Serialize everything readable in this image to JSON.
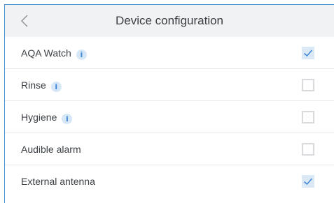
{
  "header": {
    "title": "Device configuration",
    "back_icon": "chevron-left-icon"
  },
  "info_icon_glyph": "i",
  "colors": {
    "accent": "#3d86d6",
    "checked_bg": "#dbe9f7",
    "header_bg": "#f1f2f4",
    "info_bg": "#d6e8f8"
  },
  "settings": [
    {
      "label": "AQA Watch",
      "has_info": true,
      "checked": true
    },
    {
      "label": "Rinse",
      "has_info": true,
      "checked": false
    },
    {
      "label": "Hygiene",
      "has_info": true,
      "checked": false
    },
    {
      "label": "Audible alarm",
      "has_info": false,
      "checked": false
    },
    {
      "label": "External antenna",
      "has_info": false,
      "checked": true
    }
  ]
}
